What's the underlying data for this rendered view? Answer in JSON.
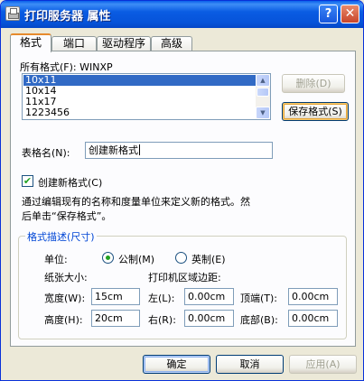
{
  "window": {
    "title": "打印服务器 属性",
    "help_label": "?",
    "close_label": "✕"
  },
  "tabs": [
    {
      "label": "格式"
    },
    {
      "label": "端口"
    },
    {
      "label": "驱动程序"
    },
    {
      "label": "高级"
    }
  ],
  "formats": {
    "label": "所有格式(F): WINXP",
    "items": [
      "10x11",
      "10x14",
      "11x17",
      "1223456"
    ],
    "selected_index": 0,
    "delete_label": "删除(D)",
    "save_label": "保存格式(S)"
  },
  "form_name": {
    "label": "表格名(N):",
    "value": "创建新格式"
  },
  "create_new": {
    "label": "创建新格式(C)",
    "checked": true,
    "description_line1": "通过编辑现有的名称和度量单位来定义新的格式。然",
    "description_line2": "后单击“保存格式”。"
  },
  "description_group": {
    "title": "格式描述(尺寸)",
    "unit_label": "单位:",
    "metric_label": "公制(M)",
    "english_label": "英制(E)",
    "unit_selected": "metric",
    "paper_size_label": "纸张大小:",
    "printer_area_label": "打印机区域边距:",
    "width_label": "宽度(W):",
    "width_value": "15cm",
    "height_label": "高度(H):",
    "height_value": "20cm",
    "left_label": "左(L):",
    "left_value": "0.00cm",
    "right_label": "右(R):",
    "right_value": "0.00cm",
    "top_label": "顶端(T):",
    "top_value": "0.00cm",
    "bottom_label": "底部(B):",
    "bottom_value": "0.00cm"
  },
  "buttons": {
    "ok": "确定",
    "cancel": "取消",
    "apply": "应用(A)"
  },
  "colors": {
    "titlebar": "#0A5CE3",
    "selection": "#316AC5",
    "group_title": "#0046D5",
    "dialog_face": "#ECE9D8"
  }
}
